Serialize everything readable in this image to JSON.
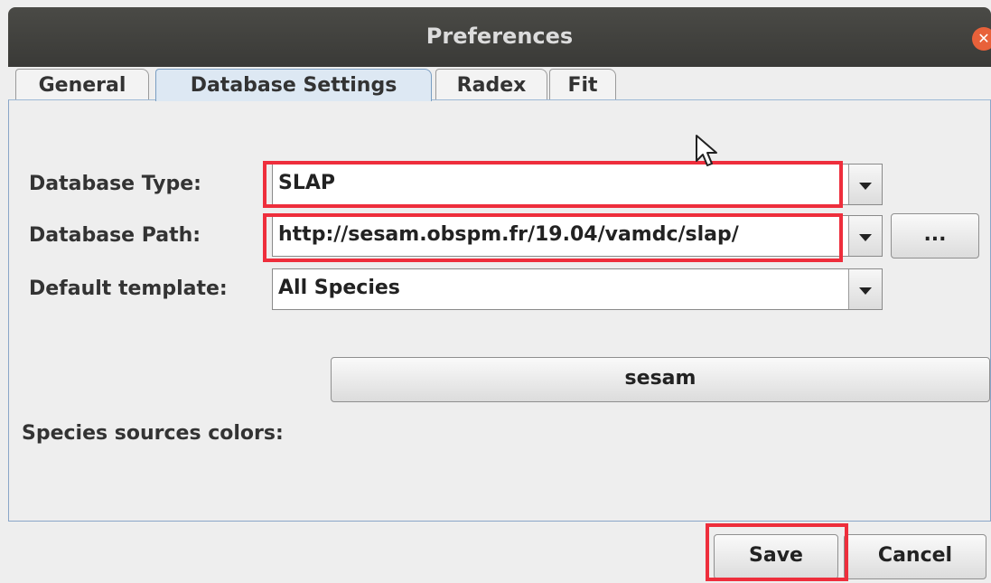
{
  "window": {
    "title": "Preferences",
    "close_icon": "close-icon"
  },
  "tabs": [
    {
      "label": "General",
      "active": false
    },
    {
      "label": "Database Settings",
      "active": true
    },
    {
      "label": "Radex",
      "active": false
    },
    {
      "label": "Fit",
      "active": false
    }
  ],
  "form": {
    "db_type_label": "Database Type:",
    "db_type_value": "SLAP",
    "db_path_label": "Database Path:",
    "db_path_value": "http://sesam.obspm.fr/19.04/vamdc/slap/",
    "browse_label": "...",
    "template_label": "Default template:",
    "template_value": "All Species",
    "source_button_label": "sesam",
    "species_colors_label": "Species sources colors:"
  },
  "footer": {
    "save_label": "Save",
    "cancel_label": "Cancel"
  },
  "colors": {
    "highlight": "#ee2e3c",
    "titlebar": "#3f3f3c",
    "tab_active": "#dde8f3"
  }
}
